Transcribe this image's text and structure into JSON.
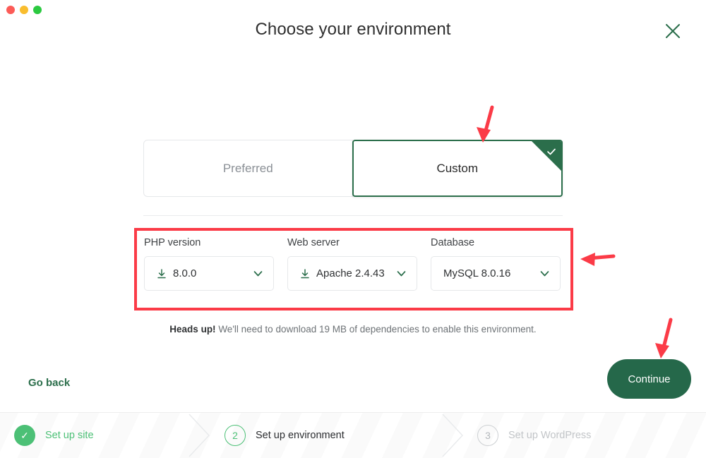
{
  "window": {
    "title": "Choose your environment",
    "close_icon": "close-x-icon",
    "traffic_lights": [
      "close-red",
      "minimize-yellow",
      "maximize-green"
    ]
  },
  "segmented_control": {
    "tabs": [
      {
        "label": "Preferred",
        "selected": false
      },
      {
        "label": "Custom",
        "selected": true,
        "check_icon": "check-icon"
      }
    ]
  },
  "selectors": [
    {
      "label": "PHP version",
      "value": "8.0.0",
      "has_download_icon": true,
      "download_icon": "download-icon",
      "chevron_icon": "chevron-down-icon"
    },
    {
      "label": "Web server",
      "value": "Apache 2.4.43",
      "has_download_icon": true,
      "download_icon": "download-icon",
      "chevron_icon": "chevron-down-icon"
    },
    {
      "label": "Database",
      "value": "MySQL 8.0.16",
      "has_download_icon": false,
      "chevron_icon": "chevron-down-icon"
    }
  ],
  "notice": {
    "bold": "Heads up!",
    "text": " We'll need to download 19 MB of dependencies to enable this environment.",
    "download_size": "19 MB"
  },
  "actions": {
    "go_back": "Go back",
    "continue": "Continue"
  },
  "footer": {
    "steps": [
      {
        "marker": "✓",
        "label": "Set up site",
        "state": "done"
      },
      {
        "marker": "2",
        "label": "Set up environment",
        "state": "current"
      },
      {
        "marker": "3",
        "label": "Set up WordPress",
        "state": "todo"
      }
    ]
  },
  "annotations": {
    "highlight_box_color": "#fb3b47",
    "arrow_color": "#fb3b47",
    "arrows": [
      {
        "name": "arrow-to-custom-tab",
        "points_to": "Custom"
      },
      {
        "name": "arrow-to-selectors",
        "points_to": "selector row"
      },
      {
        "name": "arrow-to-continue",
        "points_to": "Continue"
      }
    ]
  },
  "colors": {
    "brand_green": "#25684a",
    "accent_green": "#2b6e4b",
    "step_green": "#4cc076",
    "annotation_red": "#fb3b47"
  }
}
